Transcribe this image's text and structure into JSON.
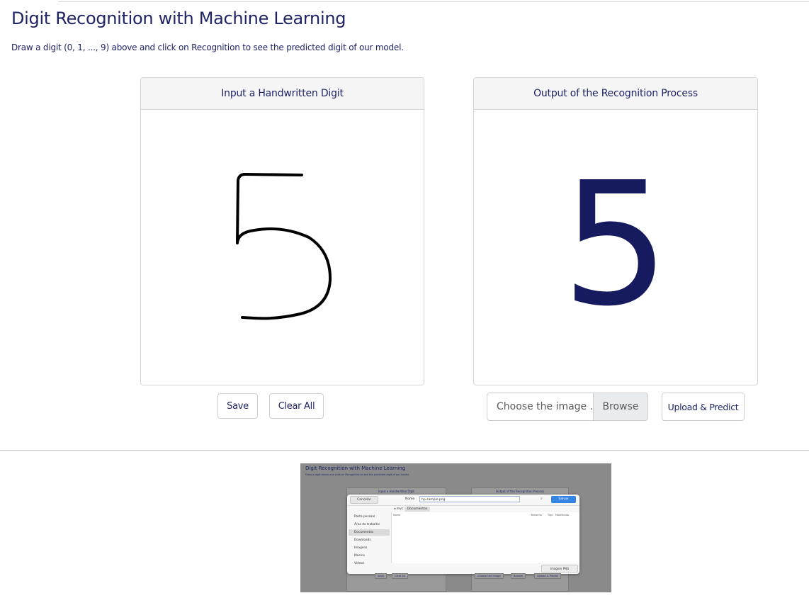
{
  "page": {
    "title": "Digit Recognition with Machine Learning",
    "subtitle": "Draw a digit (0, 1, ..., 9) above and click on Recognition to see the predicted digit of our model."
  },
  "input_card": {
    "header": "Input a Handwritten Digit",
    "save_label": "Save",
    "clear_label": "Clear All"
  },
  "output_card": {
    "header": "Output of the Recognition Process",
    "predicted_digit": "5",
    "file_placeholder": "Choose the image ...",
    "browse_label": "Browse",
    "upload_label": "Upload & Predict"
  },
  "screenshot_thumbnail": {
    "title": "Digit Recognition with Machine Learning",
    "subtitle": "Draw a digit above and click on Recognition to see the predicted digit of our model.",
    "input_header": "Input a Handwritten Digit",
    "output_header": "Output of the Recognition Process",
    "dialog": {
      "cancel_label": "Cancelar",
      "name_label": "Nome",
      "name_value": "hp.sample.png",
      "save_label": "Salvar",
      "crumb_home": "mvc",
      "crumb_current": "Documentos",
      "column_name": "Nome",
      "column_size": "Tamanho",
      "column_type": "Tipo",
      "column_modified": "Modificado",
      "sidebar": [
        "Pasta pessoal",
        "Área de trabalho",
        "Documentos",
        "Downloads",
        "Imagens",
        "Música",
        "Vídeos"
      ],
      "filter_label": "Imagem PNG"
    },
    "bottom_save": "Save",
    "bottom_clear": "Clear All",
    "bottom_choose": "Choose the image",
    "bottom_browse": "Browse",
    "bottom_upload": "Upload & Predict"
  },
  "colors": {
    "text_primary": "#1e2466",
    "predicted_digit": "#161a5e",
    "card_header_bg": "#f5f5f5",
    "browse_bg": "#e9ecef",
    "dialog_save": "#3584e4"
  }
}
